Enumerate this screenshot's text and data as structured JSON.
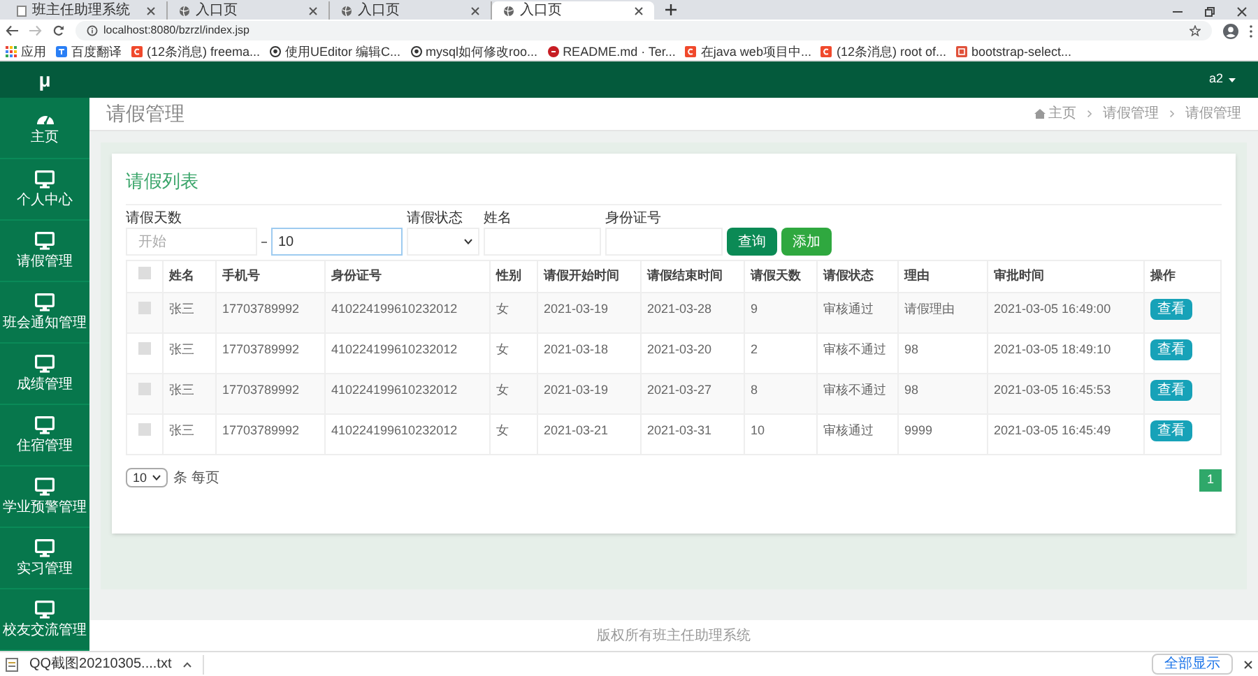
{
  "browser": {
    "tabs": [
      {
        "title": "班主任助理系统",
        "selected": false
      },
      {
        "title": "入口页",
        "selected": false
      },
      {
        "title": "入口页",
        "selected": false
      },
      {
        "title": "入口页",
        "selected": true
      }
    ],
    "url": "localhost:8080/bzrzl/index.jsp",
    "bookmarks": [
      {
        "label": "应用",
        "kind": "apps"
      },
      {
        "label": "百度翻译",
        "kind": "translate"
      },
      {
        "label": "(12条消息) freema...",
        "kind": "csdn"
      },
      {
        "label": "使用UEditor 编辑C...",
        "kind": "github"
      },
      {
        "label": "mysql如何修改roo...",
        "kind": "github"
      },
      {
        "label": "README.md · Ter...",
        "kind": "gitee"
      },
      {
        "label": "在java web项目中...",
        "kind": "csdn"
      },
      {
        "label": "(12条消息) root of...",
        "kind": "csdn"
      },
      {
        "label": "bootstrap-select...",
        "kind": "page"
      }
    ]
  },
  "app": {
    "brand": "μ",
    "user": "a2",
    "sidebar": {
      "items": [
        {
          "label": "主页",
          "kind": "gauge"
        },
        {
          "label": "个人中心",
          "kind": "monitor"
        },
        {
          "label": "请假管理",
          "kind": "monitor"
        },
        {
          "label": "班会通知管理",
          "kind": "monitor"
        },
        {
          "label": "成绩管理",
          "kind": "monitor"
        },
        {
          "label": "住宿管理",
          "kind": "monitor"
        },
        {
          "label": "学业预警管理",
          "kind": "monitor"
        },
        {
          "label": "实习管理",
          "kind": "monitor"
        },
        {
          "label": "校友交流管理",
          "kind": "monitor"
        }
      ]
    },
    "page_title": "请假管理",
    "breadcrumb": [
      "主页",
      "请假管理",
      "请假管理"
    ],
    "card": {
      "title": "请假列表",
      "filters": {
        "days_label": "请假天数",
        "days_from": {
          "placeholder": "开始"
        },
        "days_to": {
          "value": "10"
        },
        "status_label": "请假状态",
        "name_label": "姓名",
        "id_label": "身份证号"
      },
      "buttons": [
        {
          "label": "查询",
          "kind": "search"
        },
        {
          "label": "添加",
          "kind": "add"
        }
      ],
      "table": {
        "header_checked": false,
        "columns": [
          "姓名",
          "手机号",
          "身份证号",
          "性别",
          "请假开始时间",
          "请假结束时间",
          "请假天数",
          "请假状态",
          "理由",
          "审批时间",
          "操作"
        ],
        "rows": [
          {
            "checked": false,
            "cells": [
              "张三",
              "17703789992",
              "410224199610232012",
              "女",
              "2021-03-19",
              "2021-03-28",
              "9",
              "审核通过",
              "请假理由",
              "2021-03-05 16:49:00"
            ],
            "action": "查看"
          },
          {
            "checked": false,
            "cells": [
              "张三",
              "17703789992",
              "410224199610232012",
              "女",
              "2021-03-18",
              "2021-03-20",
              "2",
              "审核不通过",
              "98",
              "2021-03-05 18:49:10"
            ],
            "action": "查看"
          },
          {
            "checked": false,
            "cells": [
              "张三",
              "17703789992",
              "410224199610232012",
              "女",
              "2021-03-19",
              "2021-03-27",
              "8",
              "审核不通过",
              "98",
              "2021-03-05 16:45:53"
            ],
            "action": "查看"
          },
          {
            "checked": false,
            "cells": [
              "张三",
              "17703789992",
              "410224199610232012",
              "女",
              "2021-03-21",
              "2021-03-31",
              "10",
              "审核通过",
              "9999",
              "2021-03-05 16:45:49"
            ],
            "action": "查看"
          }
        ]
      },
      "page_size": "10",
      "page_size_label": "条 每页",
      "pages": [
        {
          "label": "1",
          "selected": true
        }
      ]
    },
    "footer": "版权所有班主任助理系统"
  },
  "downloads": {
    "file": "QQ截图20210305....txt",
    "show_all": "全部显示"
  }
}
